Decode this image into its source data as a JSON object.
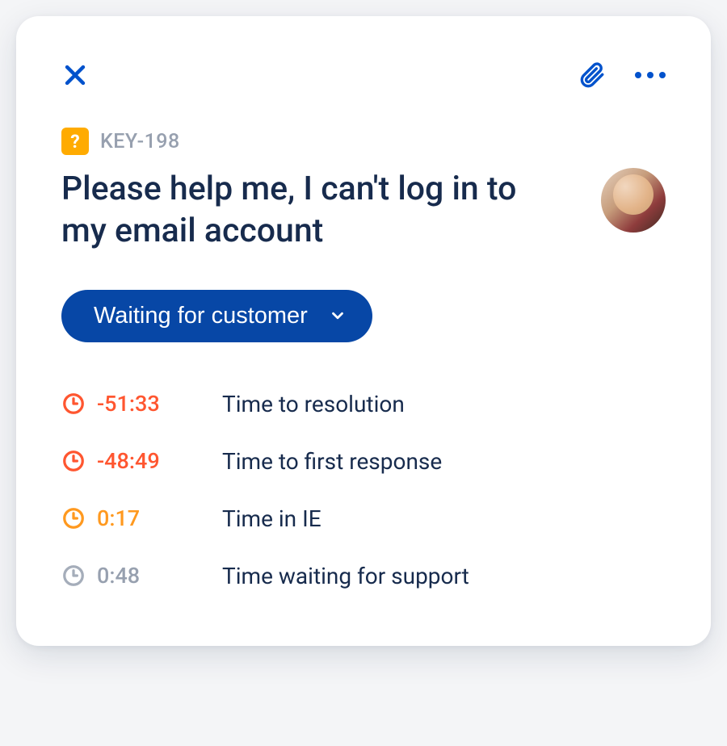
{
  "header": {},
  "issue": {
    "key": "KEY-198",
    "type_icon_glyph": "?",
    "title": "Please help me, I can't log in to my email account"
  },
  "status": {
    "label": "Waiting for customer"
  },
  "metrics": [
    {
      "value": "-51:33",
      "label": "Time to resolution",
      "state": "breached"
    },
    {
      "value": "-48:49",
      "label": "Time to first response",
      "state": "breached"
    },
    {
      "value": "0:17",
      "label": "Time in IE",
      "state": "warning"
    },
    {
      "value": "0:48",
      "label": "Time waiting for support",
      "state": "idle"
    }
  ]
}
